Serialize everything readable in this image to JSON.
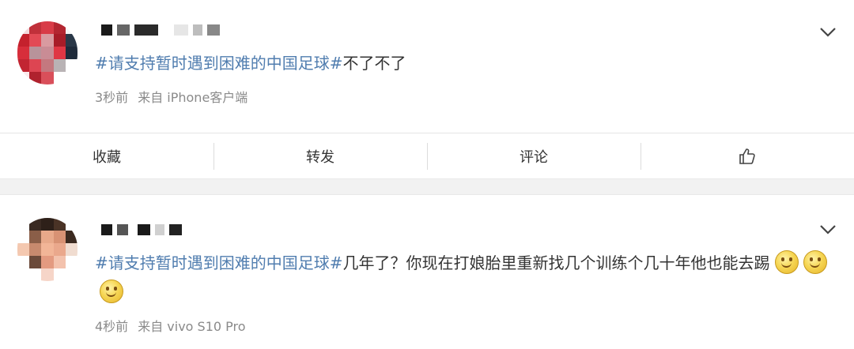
{
  "posts": [
    {
      "topic": "#请支持暂时遇到困难的中国足球#",
      "content": "不了不了",
      "time": "3秒前",
      "source": "来自 iPhone客户端",
      "avatar_icon": "pixelated-avatar-icon"
    },
    {
      "topic": "#请支持暂时遇到困难的中国足球#",
      "content": "几年了？你现在打娘胎里重新找几个训练个几十年他也能去踢",
      "time": "4秒前",
      "source": "来自 vivo S10 Pro",
      "avatar_icon": "pixelated-avatar-icon",
      "emoji_icon": "smile-emoji-icon"
    }
  ],
  "actions": {
    "favorite": "收藏",
    "repost": "转发",
    "comment": "评论",
    "like_icon": "thumbs-up-icon"
  },
  "colors": {
    "topic": "#507daf",
    "meta": "#8a8a8a",
    "separator": "#f2f2f2"
  }
}
